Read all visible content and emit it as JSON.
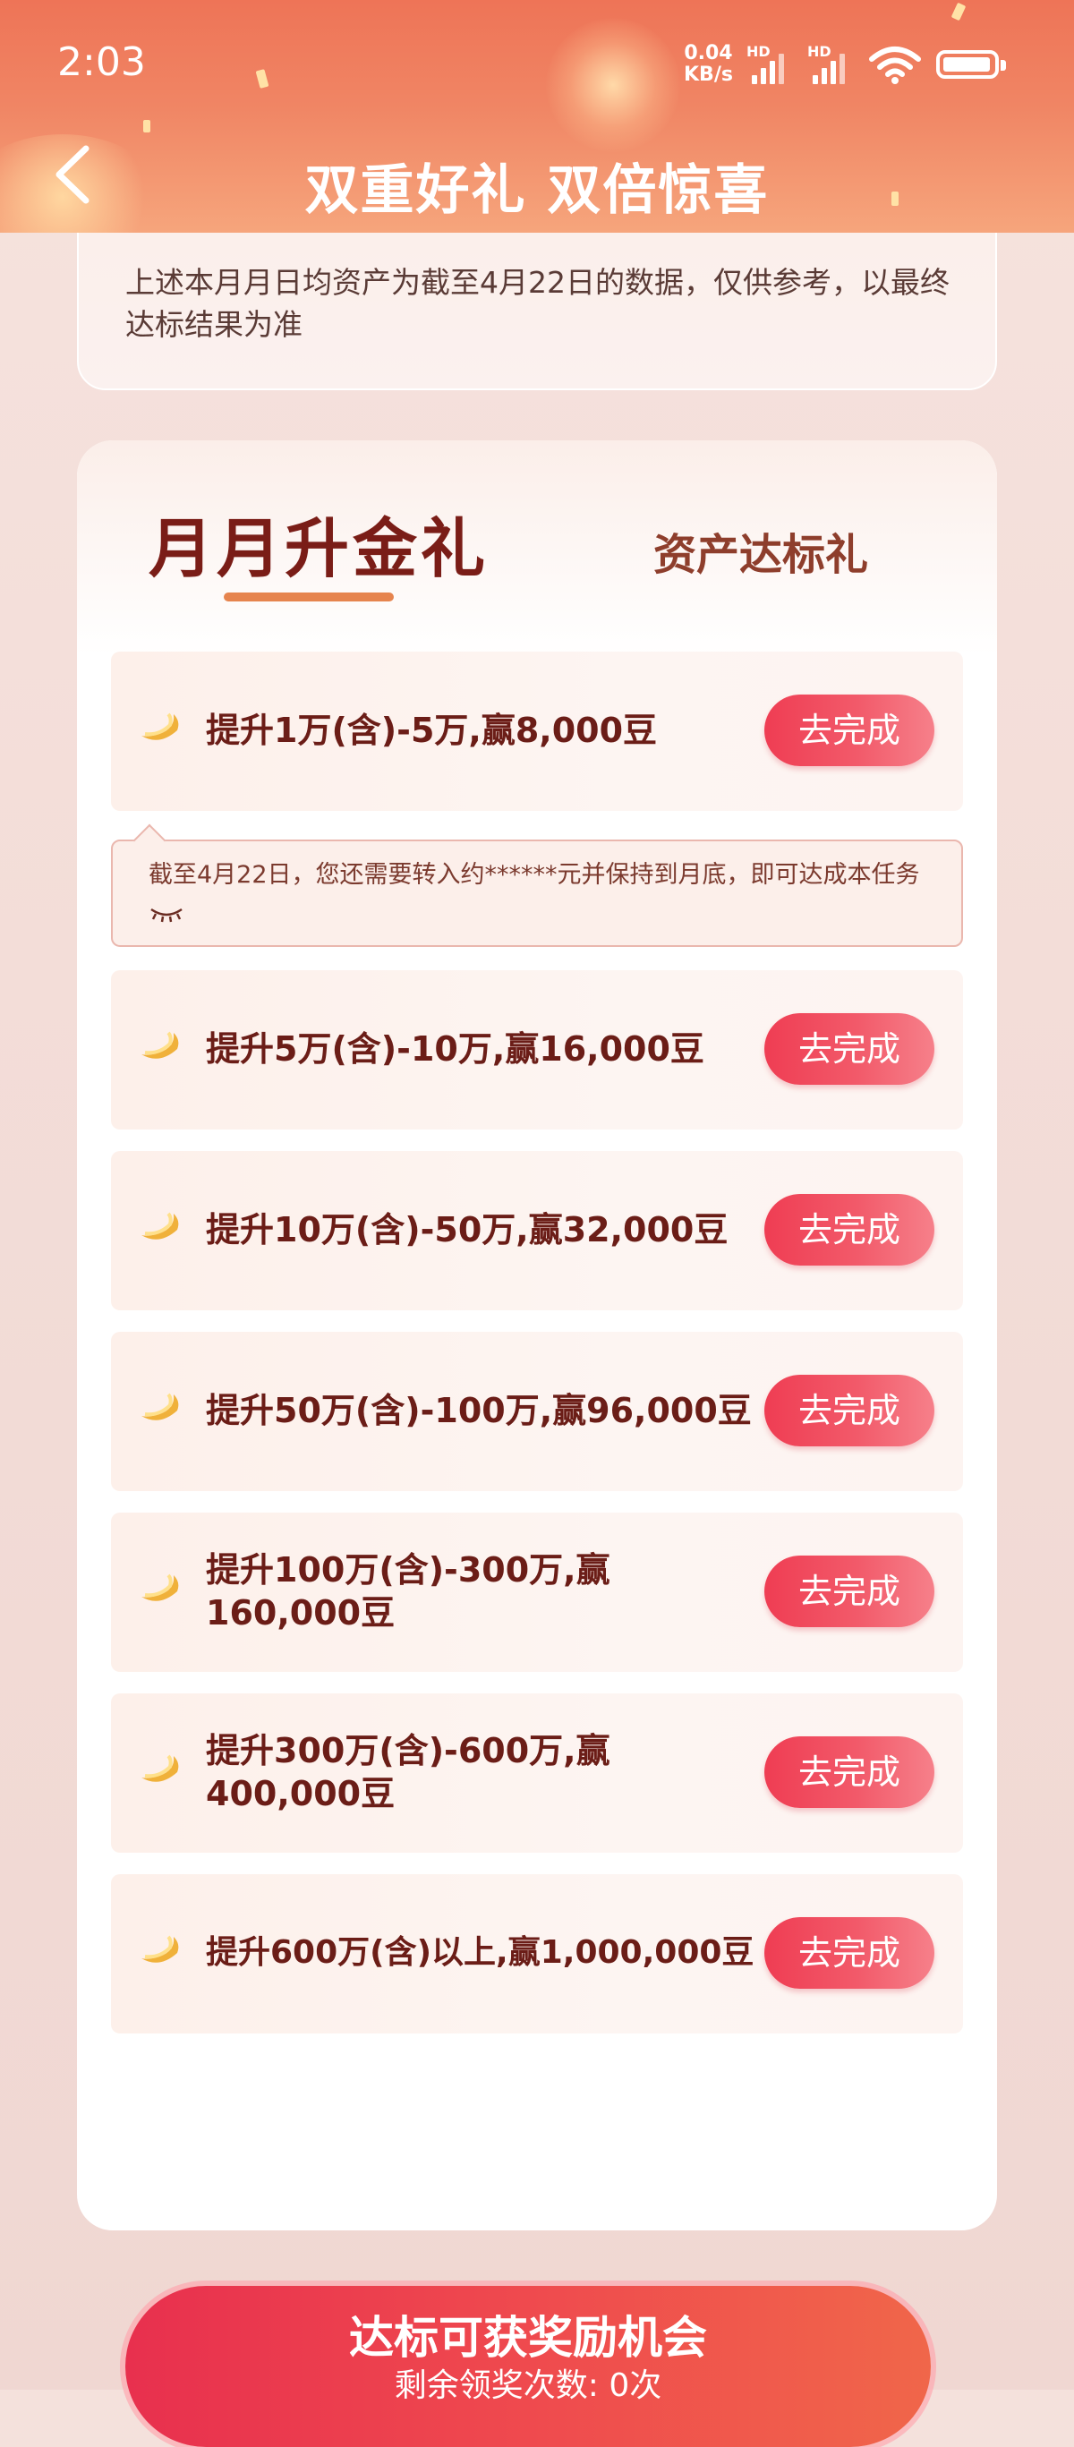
{
  "status_bar": {
    "time": "2:03",
    "net_speed": "0.04",
    "net_unit": "KB/s",
    "hd1": "HD",
    "hd2": "HD"
  },
  "header": {
    "title": "双重好礼 双倍惊喜"
  },
  "note": {
    "text": "上述本月月日均资产为截至4月22日的数据，仅供参考，以最终达标结果为准"
  },
  "tabs": [
    {
      "label": "月月升金礼",
      "active": true
    },
    {
      "label": "资产达标礼",
      "active": false
    }
  ],
  "tip": {
    "text": "截至4月22日，您还需要转入约******元并保持到月底，即可达成本任务"
  },
  "tasks": [
    {
      "label": "提升1万(含)-5万,赢8,000豆",
      "button": "去完成"
    },
    {
      "label": "提升5万(含)-10万,赢16,000豆",
      "button": "去完成"
    },
    {
      "label": "提升10万(含)-50万,赢32,000豆",
      "button": "去完成"
    },
    {
      "label": "提升50万(含)-100万,赢96,000豆",
      "button": "去完成"
    },
    {
      "label": "提升100万(含)-300万,赢160,000豆",
      "button": "去完成"
    },
    {
      "label": "提升300万(含)-600万,赢400,000豆",
      "button": "去完成"
    },
    {
      "label": "提升600万(含)以上,赢1,000,000豆",
      "button": "去完成"
    }
  ],
  "bottom": {
    "title": "达标可获奖励机会",
    "subtitle": "剩余领奖次数: 0次"
  },
  "colors": {
    "header": "#ee7457",
    "accent_red": "#ef3d53",
    "title_text": "#7a1d17",
    "underline": "#e6844e"
  }
}
